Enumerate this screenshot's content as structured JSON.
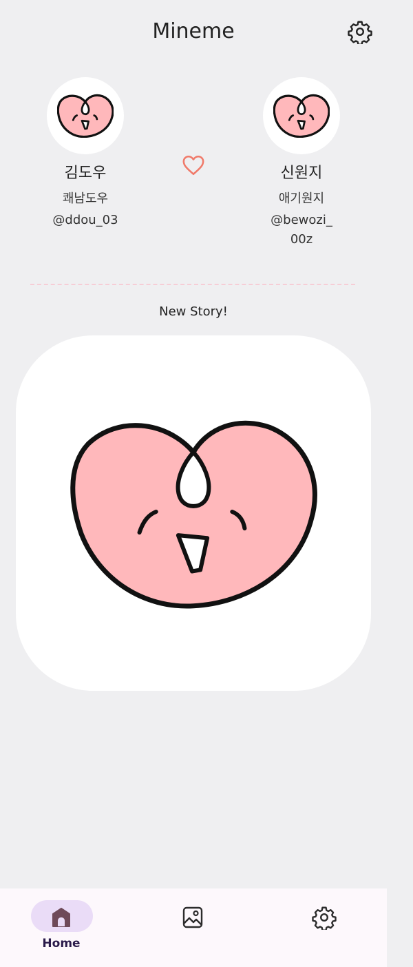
{
  "header": {
    "title": "Mineme",
    "settings_icon": "gear-icon"
  },
  "profiles": [
    {
      "name": "김도우",
      "nickname": "쾌남도우",
      "handle": "@ddou_03",
      "avatar_icon": "heart-face-avatar"
    },
    {
      "name": "신원지",
      "nickname": "애기원지",
      "handle": "@bewozi_00z",
      "avatar_icon": "heart-face-avatar"
    }
  ],
  "link_icon": "heart-outline-icon",
  "story": {
    "label": "New Story!",
    "image_icon": "heart-face-illustration"
  },
  "bottom_nav": {
    "items": [
      {
        "label": "Home",
        "icon": "home-icon",
        "selected": true
      },
      {
        "label": "",
        "icon": "image-icon",
        "selected": false
      },
      {
        "label": "",
        "icon": "gear-icon",
        "selected": false
      }
    ]
  },
  "colors": {
    "background": "#efeff1",
    "heart_fill": "#ffb8bb",
    "heart_accent": "#f07a6a",
    "nav_pill": "#eadcf7",
    "divider": "#f6cdd6"
  }
}
